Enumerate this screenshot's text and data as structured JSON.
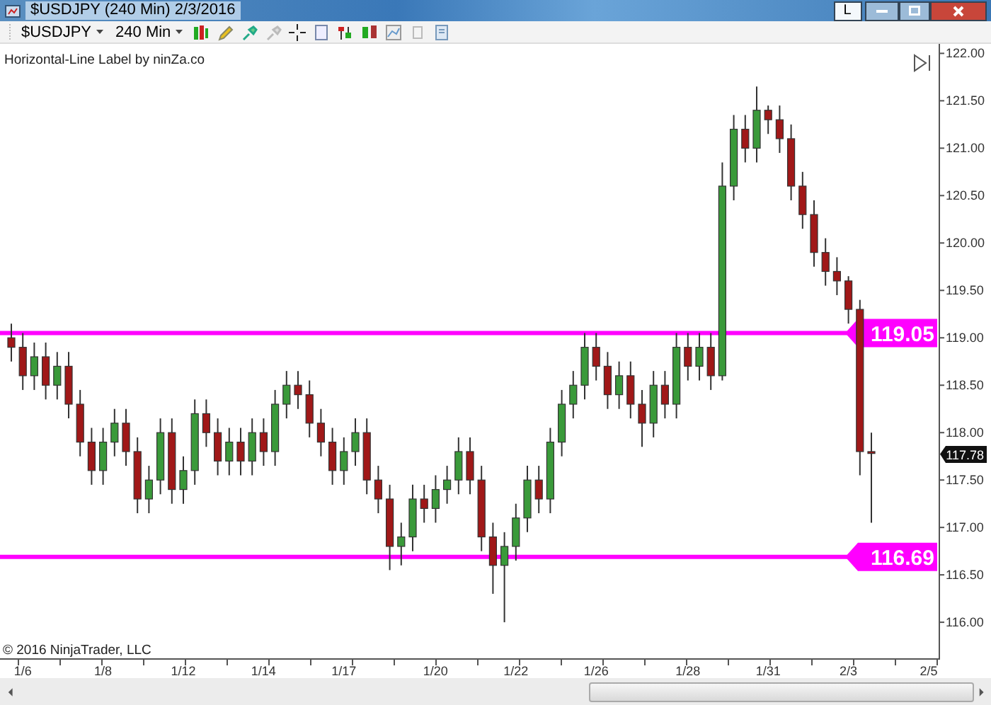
{
  "window": {
    "title": "$USDJPY (240 Min)  2/3/2016",
    "link_button": "L"
  },
  "toolbar": {
    "instrument": "$USDJPY",
    "interval": "240 Min"
  },
  "chart": {
    "indicator_label": "Horizontal-Line Label by ninZa.co",
    "copyright": "© 2016 NinjaTrader, LLC",
    "last_price": "117.78",
    "chart_data": {
      "type": "candlestick",
      "ylim": [
        115.62,
        122.1
      ],
      "ref_lines": [
        {
          "axis": "y",
          "value": 119.05,
          "label": "119.05",
          "color": "#ff00ff"
        },
        {
          "axis": "y",
          "value": 116.69,
          "label": "116.69",
          "color": "#ff00ff"
        }
      ],
      "yticks": [
        {
          "value": 122,
          "label": "122.00"
        },
        {
          "value": 121.5,
          "label": "121.50"
        },
        {
          "value": 121,
          "label": "121.00"
        },
        {
          "value": 120.5,
          "label": "120.50"
        },
        {
          "value": 120,
          "label": "120.00"
        },
        {
          "value": 119.5,
          "label": "119.50"
        },
        {
          "value": 119,
          "label": "119.00"
        },
        {
          "value": 118.5,
          "label": "118.50"
        },
        {
          "value": 118,
          "label": "118.00"
        },
        {
          "value": 117.5,
          "label": "117.50"
        },
        {
          "value": 117,
          "label": "117.00"
        },
        {
          "value": 116.5,
          "label": "116.50"
        },
        {
          "value": 116,
          "label": "116.00"
        }
      ],
      "categories": [
        null,
        "1/6",
        null,
        null,
        null,
        null,
        null,
        null,
        "1/8",
        null,
        null,
        null,
        null,
        null,
        null,
        "1/12",
        null,
        null,
        null,
        null,
        null,
        null,
        "1/14",
        null,
        null,
        null,
        null,
        null,
        null,
        "1/17",
        null,
        null,
        null,
        null,
        null,
        null,
        null,
        "1/20",
        null,
        null,
        null,
        null,
        null,
        null,
        "1/22",
        null,
        null,
        null,
        null,
        null,
        null,
        "1/26",
        null,
        null,
        null,
        null,
        null,
        null,
        null,
        "1/28",
        null,
        null,
        null,
        null,
        null,
        null,
        "1/31",
        null,
        null,
        null,
        null,
        null,
        null,
        "2/3",
        null,
        null,
        null,
        null,
        null,
        null,
        "2/5"
      ],
      "ohlc": [
        [
          119.0,
          119.15,
          118.75,
          118.9
        ],
        [
          118.9,
          119.05,
          118.45,
          118.6
        ],
        [
          118.6,
          118.95,
          118.45,
          118.8
        ],
        [
          118.8,
          118.95,
          118.35,
          118.5
        ],
        [
          118.5,
          118.85,
          118.35,
          118.7
        ],
        [
          118.7,
          118.85,
          118.15,
          118.3
        ],
        [
          118.3,
          118.45,
          117.75,
          117.9
        ],
        [
          117.9,
          118.05,
          117.45,
          117.6
        ],
        [
          117.6,
          118.05,
          117.45,
          117.9
        ],
        [
          117.9,
          118.25,
          117.75,
          118.1
        ],
        [
          118.1,
          118.25,
          117.65,
          117.8
        ],
        [
          117.8,
          117.95,
          117.15,
          117.3
        ],
        [
          117.3,
          117.65,
          117.15,
          117.5
        ],
        [
          117.5,
          118.15,
          117.35,
          118.0
        ],
        [
          118.0,
          118.15,
          117.25,
          117.4
        ],
        [
          117.4,
          117.75,
          117.25,
          117.6
        ],
        [
          117.6,
          118.35,
          117.45,
          118.2
        ],
        [
          118.2,
          118.35,
          117.85,
          118.0
        ],
        [
          118.0,
          118.15,
          117.55,
          117.7
        ],
        [
          117.7,
          118.05,
          117.55,
          117.9
        ],
        [
          117.9,
          118.05,
          117.55,
          117.7
        ],
        [
          117.7,
          118.15,
          117.55,
          118.0
        ],
        [
          118.0,
          118.15,
          117.65,
          117.8
        ],
        [
          117.8,
          118.45,
          117.65,
          118.3
        ],
        [
          118.3,
          118.65,
          118.15,
          118.5
        ],
        [
          118.5,
          118.65,
          118.25,
          118.4
        ],
        [
          118.4,
          118.55,
          117.95,
          118.1
        ],
        [
          118.1,
          118.25,
          117.75,
          117.9
        ],
        [
          117.9,
          118.05,
          117.45,
          117.6
        ],
        [
          117.6,
          117.95,
          117.45,
          117.8
        ],
        [
          117.8,
          118.15,
          117.65,
          118.0
        ],
        [
          118.0,
          118.15,
          117.35,
          117.5
        ],
        [
          117.5,
          117.65,
          117.15,
          117.3
        ],
        [
          117.3,
          117.45,
          116.55,
          116.8
        ],
        [
          116.8,
          117.05,
          116.6,
          116.9
        ],
        [
          116.9,
          117.45,
          116.75,
          117.3
        ],
        [
          117.3,
          117.45,
          117.05,
          117.2
        ],
        [
          117.2,
          117.55,
          117.05,
          117.4
        ],
        [
          117.4,
          117.65,
          117.25,
          117.5
        ],
        [
          117.5,
          117.95,
          117.35,
          117.8
        ],
        [
          117.8,
          117.95,
          117.35,
          117.5
        ],
        [
          117.5,
          117.65,
          116.75,
          116.9
        ],
        [
          116.9,
          117.05,
          116.3,
          116.6
        ],
        [
          116.6,
          116.95,
          116.0,
          116.8
        ],
        [
          116.8,
          117.25,
          116.65,
          117.1
        ],
        [
          117.1,
          117.65,
          116.95,
          117.5
        ],
        [
          117.5,
          117.65,
          117.15,
          117.3
        ],
        [
          117.3,
          118.05,
          117.15,
          117.9
        ],
        [
          117.9,
          118.45,
          117.75,
          118.3
        ],
        [
          118.3,
          118.65,
          118.15,
          118.5
        ],
        [
          118.5,
          119.05,
          118.35,
          118.9
        ],
        [
          118.9,
          119.05,
          118.55,
          118.7
        ],
        [
          118.7,
          118.85,
          118.25,
          118.4
        ],
        [
          118.4,
          118.75,
          118.25,
          118.6
        ],
        [
          118.6,
          118.75,
          118.15,
          118.3
        ],
        [
          118.3,
          118.45,
          117.85,
          118.1
        ],
        [
          118.1,
          118.65,
          117.95,
          118.5
        ],
        [
          118.5,
          118.65,
          118.15,
          118.3
        ],
        [
          118.3,
          119.05,
          118.15,
          118.9
        ],
        [
          118.9,
          119.05,
          118.55,
          118.7
        ],
        [
          118.7,
          119.05,
          118.55,
          118.9
        ],
        [
          118.9,
          119.05,
          118.45,
          118.6
        ],
        [
          118.6,
          120.85,
          118.55,
          120.6
        ],
        [
          120.6,
          121.35,
          120.45,
          121.2
        ],
        [
          121.2,
          121.35,
          120.85,
          121.0
        ],
        [
          121.0,
          121.65,
          120.85,
          121.4
        ],
        [
          121.4,
          121.45,
          121.15,
          121.3
        ],
        [
          121.3,
          121.45,
          120.95,
          121.1
        ],
        [
          121.1,
          121.25,
          120.45,
          120.6
        ],
        [
          120.6,
          120.75,
          120.15,
          120.3
        ],
        [
          120.3,
          120.45,
          119.75,
          119.9
        ],
        [
          119.9,
          120.05,
          119.55,
          119.7
        ],
        [
          119.7,
          119.85,
          119.45,
          119.6
        ],
        [
          119.6,
          119.65,
          119.15,
          119.3
        ],
        [
          119.3,
          119.4,
          117.55,
          117.8
        ],
        [
          117.8,
          118.0,
          117.05,
          117.78
        ],
        null,
        null,
        null,
        null,
        null
      ]
    }
  }
}
